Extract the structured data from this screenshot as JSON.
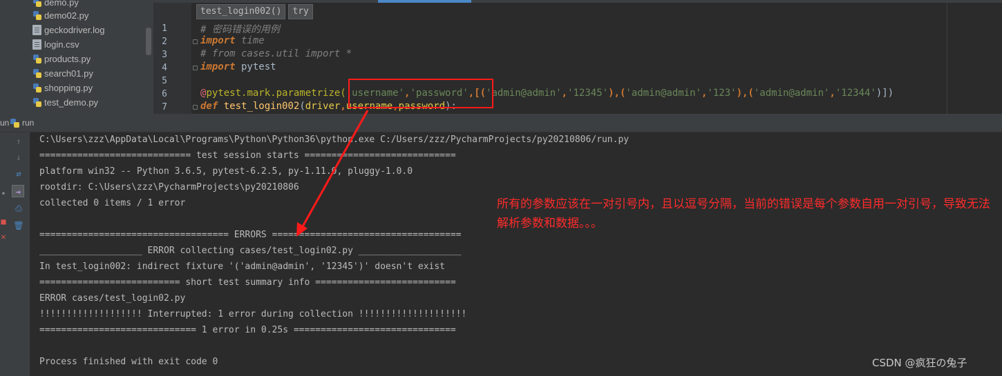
{
  "project_tree": {
    "items": [
      {
        "name": "demo.py",
        "type": "py"
      },
      {
        "name": "demo02.py",
        "type": "py"
      },
      {
        "name": "geckodriver.log",
        "type": "doc"
      },
      {
        "name": "login.csv",
        "type": "doc"
      },
      {
        "name": "products.py",
        "type": "py"
      },
      {
        "name": "search01.py",
        "type": "py"
      },
      {
        "name": "shopping.py",
        "type": "py"
      },
      {
        "name": "test_demo.py",
        "type": "py"
      }
    ]
  },
  "editor": {
    "breadcrumb": [
      "test_login002()",
      "try"
    ],
    "line_numbers": [
      "1",
      "2",
      "3",
      "4",
      "5",
      "6",
      "7"
    ],
    "lines": {
      "l1_comment": "# 密码错误的用例",
      "l2_kw": "import",
      "l2_rest": " time",
      "l3_comment": "# from cases.util import *",
      "l4_kw": "import",
      "l4_rest": " pytest",
      "l6_at": "@",
      "l6_decorator": "pytest.mark.parametrize(",
      "l6_s1": "'username'",
      "l6_c1": ",",
      "l6_s2": "'password'",
      "l6_c2": ",[(",
      "l6_s3": "'admin@admin'",
      "l6_c3": ",",
      "l6_s4": "'12345'",
      "l6_c4": "),(",
      "l6_s5": "'admin@admin'",
      "l6_c5": ",",
      "l6_s6": "'123'",
      "l6_c6": "),(",
      "l6_s7": "'admin@admin'",
      "l6_c7": ",",
      "l6_s8": "'12344'",
      "l6_c8": ")])",
      "l7_kw": "def",
      "l7_fn": " test_login002",
      "l7_open": "(",
      "l7_p1": "driver",
      "l7_c1": ",",
      "l7_p2": "username",
      "l7_c2": ",",
      "l7_p3": "password",
      "l7_close": "):"
    }
  },
  "run_panel": {
    "title_prefix": "un",
    "title": "run"
  },
  "console": {
    "lines": [
      "C:\\Users\\zzz\\AppData\\Local\\Programs\\Python\\Python36\\python.exe C:/Users/zzz/PycharmProjects/py20210806/run.py",
      "============================ test session starts ============================",
      "platform win32 -- Python 3.6.5, pytest-6.2.5, py-1.11.0, pluggy-1.0.0",
      "rootdir: C:\\Users\\zzz\\PycharmProjects\\py20210806",
      "collected 0 items / 1 error",
      "",
      "=================================== ERRORS ===================================",
      "___________________ ERROR collecting cases/test_login02.py ___________________",
      "In test_login002: indirect fixture '('admin@admin', '12345')' doesn't exist",
      "========================== short test summary info ==========================",
      "ERROR cases/test_login02.py",
      "!!!!!!!!!!!!!!!!!!! Interrupted: 1 error during collection !!!!!!!!!!!!!!!!!!!!",
      "============================= 1 error in 0.25s ==============================",
      "",
      "Process finished with exit code 0"
    ]
  },
  "annotation": {
    "text": "所有的参数应该在一对引号内，且以逗号分隔，当前的错误是每个参数自用一对引号，导致无法解析参数和数据。。。",
    "color": "#ff2b2b"
  },
  "watermark": "CSDN @疯狂の兔子",
  "colors": {
    "keyword": "#cc7832",
    "string": "#6a8759",
    "decorator": "#bbb529",
    "function": "#ffc66d",
    "comment": "#808080",
    "annotation_red": "#ff1a1a"
  }
}
